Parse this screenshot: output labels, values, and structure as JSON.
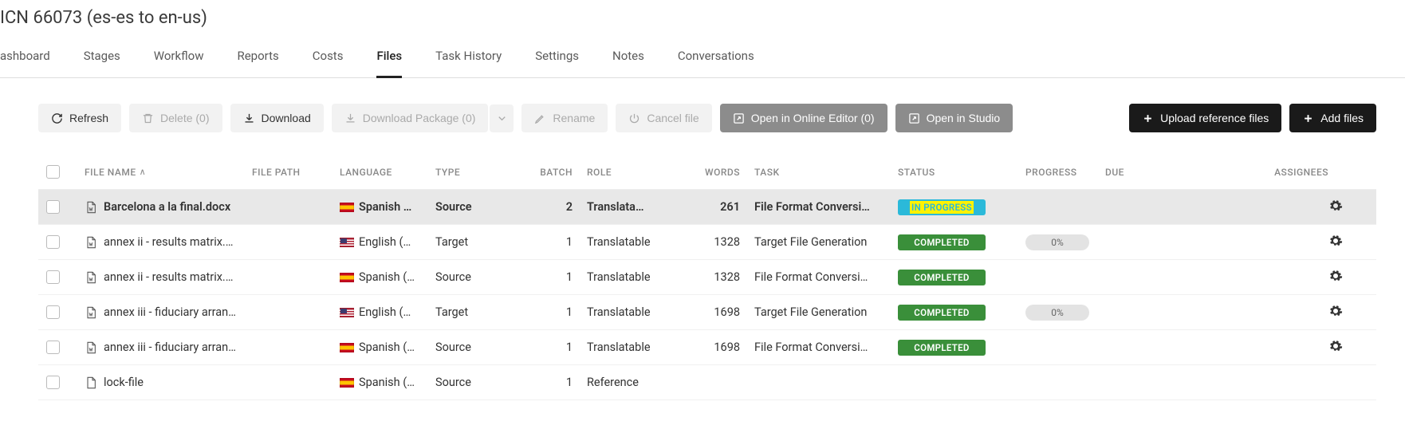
{
  "header": {
    "title": "ICN 66073 (es-es to en-us)"
  },
  "tabs": [
    {
      "label": "ashboard",
      "active": false
    },
    {
      "label": "Stages",
      "active": false
    },
    {
      "label": "Workflow",
      "active": false
    },
    {
      "label": "Reports",
      "active": false
    },
    {
      "label": "Costs",
      "active": false
    },
    {
      "label": "Files",
      "active": true
    },
    {
      "label": "Task History",
      "active": false
    },
    {
      "label": "Settings",
      "active": false
    },
    {
      "label": "Notes",
      "active": false
    },
    {
      "label": "Conversations",
      "active": false
    }
  ],
  "toolbar": {
    "refresh": "Refresh",
    "delete": "Delete (0)",
    "download": "Download",
    "download_package": "Download Package (0)",
    "rename": "Rename",
    "cancel_file": "Cancel file",
    "open_online_editor": "Open in Online Editor (0)",
    "open_studio": "Open in Studio",
    "upload_reference": "Upload reference files",
    "add_files": "Add files"
  },
  "columns": {
    "file_name": "FILE NAME",
    "file_path": "FILE PATH",
    "language": "LANGUAGE",
    "type": "TYPE",
    "batch": "BATCH",
    "role": "ROLE",
    "words": "WORDS",
    "task": "TASK",
    "status": "STATUS",
    "progress": "PROGRESS",
    "due": "DUE",
    "assignees": "ASSIGNEES"
  },
  "status_labels": {
    "in_progress": "IN PROGRESS",
    "completed": "COMPLETED"
  },
  "rows": [
    {
      "selected": true,
      "file_icon": "doc",
      "file_name": "Barcelona a la final.docx",
      "file_path": "",
      "flag": "es",
      "language": "Spanish …",
      "type": "Source",
      "batch": "2",
      "batch_highlight": true,
      "role": "Translata…",
      "words": "261",
      "task": "File Format Conversi…",
      "status": "in_progress",
      "progress": "",
      "due": "",
      "gear": true
    },
    {
      "selected": false,
      "file_icon": "doc",
      "file_name": "annex ii - results matrix.…",
      "file_path": "",
      "flag": "us",
      "language": "English (…",
      "type": "Target",
      "batch": "1",
      "role": "Translatable",
      "words": "1328",
      "task": "Target File Generation",
      "status": "completed",
      "progress": "0%",
      "due": "",
      "gear": true
    },
    {
      "selected": false,
      "file_icon": "doc",
      "file_name": "annex ii - results matrix.…",
      "file_path": "",
      "flag": "es",
      "language": "Spanish (…",
      "type": "Source",
      "batch": "1",
      "role": "Translatable",
      "words": "1328",
      "task": "File Format Conversi…",
      "status": "completed",
      "progress": "",
      "due": "",
      "gear": true
    },
    {
      "selected": false,
      "file_icon": "doc",
      "file_name": "annex iii - fiduciary arran…",
      "file_path": "",
      "flag": "us",
      "language": "English (…",
      "type": "Target",
      "batch": "1",
      "role": "Translatable",
      "words": "1698",
      "task": "Target File Generation",
      "status": "completed",
      "progress": "0%",
      "due": "",
      "gear": true
    },
    {
      "selected": false,
      "file_icon": "doc",
      "file_name": "annex iii - fiduciary arran…",
      "file_path": "",
      "flag": "es",
      "language": "Spanish (…",
      "type": "Source",
      "batch": "1",
      "role": "Translatable",
      "words": "1698",
      "task": "File Format Conversi…",
      "status": "completed",
      "progress": "",
      "due": "",
      "gear": true
    },
    {
      "selected": false,
      "file_icon": "generic",
      "file_name": "lock-file",
      "file_path": "",
      "flag": "es",
      "language": "Spanish (…",
      "type": "Source",
      "batch": "1",
      "role": "Reference",
      "words": "",
      "task": "",
      "status": "",
      "progress": "",
      "due": "",
      "gear": false
    }
  ]
}
